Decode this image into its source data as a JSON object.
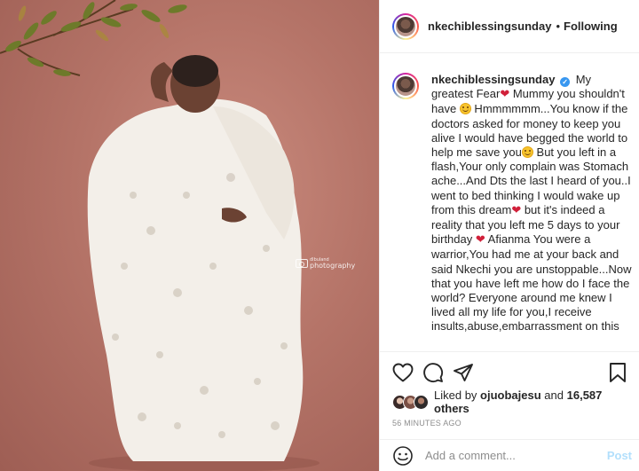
{
  "post": {
    "username": "nkechiblessingsunday",
    "dot": "•",
    "follow_status": "Following",
    "verified_mark": "✓",
    "caption_parts": [
      "My greatest Fear",
      " Mummy you shouldn't have ",
      " Hmmmmmm...You know if the doctors asked for money to keep you alive I would have begged the world to help me save you",
      " But you left in a flash,Your only complain was Stomach ache...And Dts the last I heard of you..I went to bed thinking I would wake up from this dream",
      " but it's indeed a reality that you left me 5 days to your birthday ",
      " Afianma You were a warrior,You had me at your back and said Nkechi you are unstoppable...Now that you have left me how do I face the world? Everyone around me knew I lived all my life for you,I receive insults,abuse,embarrassment on this"
    ],
    "heart_icon_glyph": "❤",
    "watermark": {
      "brand": "photography",
      "small": "dlbuland"
    }
  },
  "engagement": {
    "liked_by_label": "Liked by",
    "liked_by_user": "ojuobajesu",
    "and_label": "and",
    "likes_count": "16,587 others",
    "time_ago": "56 MINUTES AGO"
  },
  "comment": {
    "placeholder": "Add a comment...",
    "post_label": "Post"
  },
  "colors": {
    "accent": "#3897f0",
    "heart": "#d1203a",
    "muted": "#8e8e8e",
    "post_disabled": "#b2dffc"
  }
}
